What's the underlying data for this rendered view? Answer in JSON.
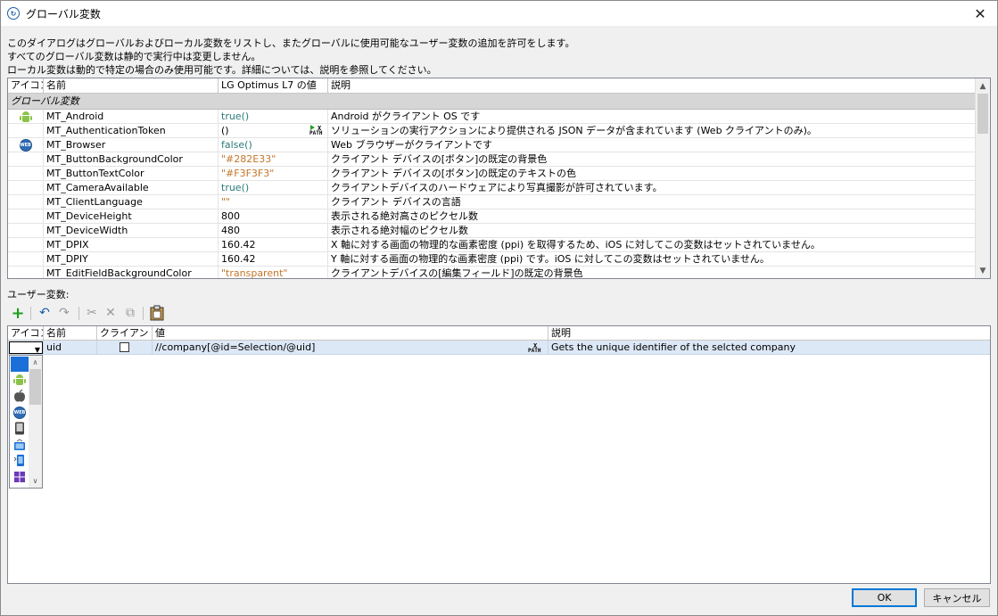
{
  "window": {
    "title": "グローバル変数",
    "close_glyph": "✕"
  },
  "description": {
    "line1": "このダイアログはグローバルおよびローカル変数をリストし、またグローバルに使用可能なユーザー変数の追加を許可をします。",
    "line2": "すべてのグローバル変数は静的で実行中は変更しません。",
    "line3": "ローカル変数は動的で特定の場合のみ使用可能です。詳細については、説明を参照してください。"
  },
  "global_grid": {
    "headers": {
      "icon": "アイコン",
      "name": "名前",
      "value": "LG Optimus L7 の値",
      "desc": "説明"
    },
    "group_label": "グローバル変数",
    "xpath_label": "PATH",
    "rows": [
      {
        "icon": "android-icon",
        "name": "MT_Android",
        "value": "true()",
        "desc": "Android がクライアント OS です"
      },
      {
        "icon": "",
        "name": "MT_AuthenticationToken",
        "value": "()",
        "desc": "ソリューションの実行アクションにより提供される JSON データが含まれています (Web クライアントのみ)。"
      },
      {
        "icon": "web-icon",
        "name": "MT_Browser",
        "value": "false()",
        "desc": "Web ブラウザーがクライアントです"
      },
      {
        "icon": "",
        "name": "MT_ButtonBackgroundColor",
        "value": "\"#282E33\"",
        "desc": "クライアント デバイスの[ボタン]の既定の背景色"
      },
      {
        "icon": "",
        "name": "MT_ButtonTextColor",
        "value": "\"#F3F3F3\"",
        "desc": "クライアント デバイスの[ボタン]の既定のテキストの色"
      },
      {
        "icon": "",
        "name": "MT_CameraAvailable",
        "value": "true()",
        "desc": "クライアントデバイスのハードウェアにより写真撮影が許可されています。"
      },
      {
        "icon": "",
        "name": "MT_ClientLanguage",
        "value": "\"\"",
        "desc": "クライアント デバイスの言語"
      },
      {
        "icon": "",
        "name": "MT_DeviceHeight",
        "value": "800",
        "desc": "表示される絶対高さのピクセル数"
      },
      {
        "icon": "",
        "name": "MT_DeviceWidth",
        "value": "480",
        "desc": "表示される絶対幅のピクセル数"
      },
      {
        "icon": "",
        "name": "MT_DPIX",
        "value": "160.42",
        "desc": "X 軸に対する画面の物理的な画素密度 (ppi) を取得するため、iOS に対してこの変数はセットされていません。"
      },
      {
        "icon": "",
        "name": "MT_DPIY",
        "value": "160.42",
        "desc": "Y 軸に対する画面の物理的な画素密度 (ppi) です。iOS に対してこの変数はセットされていません。"
      },
      {
        "icon": "",
        "name": "MT_EditFieldBackgroundColor",
        "value": "\"transparent\"",
        "desc": "クライアントデバイスの[編集フィールド]の既定の背景色"
      }
    ]
  },
  "user_vars": {
    "label": "ユーザー変数:",
    "toolbar": {
      "add": "+",
      "undo": "↶",
      "redo": "↷",
      "cut": "✂",
      "delete": "✕",
      "copy": "⧉",
      "paste": "📋"
    },
    "headers": {
      "icon": "アイコン",
      "name": "名前",
      "client": "クライアント...",
      "value": "値",
      "desc": "説明"
    },
    "row": {
      "name": "uid",
      "value": "//company[@id=Selection/@uid]",
      "desc": "Gets the unique identifier of the selcted company"
    },
    "icon_options": [
      "blank",
      "android-icon",
      "apple-icon",
      "web-icon",
      "ios-device-icon",
      "tablet-icon",
      "mobile-device-icon",
      "windows-icon"
    ]
  },
  "buttons": {
    "ok": "OK",
    "cancel": "キャンセル"
  }
}
